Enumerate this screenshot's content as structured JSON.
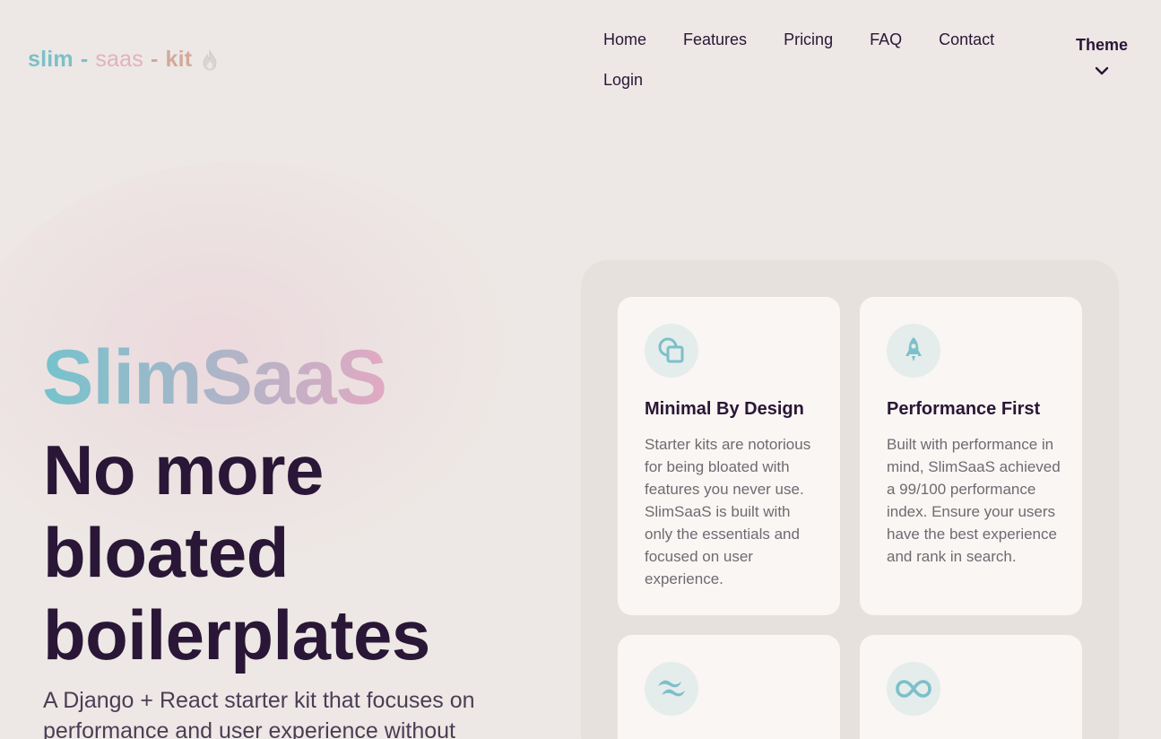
{
  "logo": {
    "part1": "slim",
    "sep1": "-",
    "part2": "saas",
    "sep2": "-",
    "part3": "kit",
    "icon": "flame-icon"
  },
  "nav": {
    "items": [
      {
        "label": "Home"
      },
      {
        "label": "Features"
      },
      {
        "label": "Pricing"
      },
      {
        "label": "FAQ"
      },
      {
        "label": "Contact"
      },
      {
        "label": "Login"
      }
    ]
  },
  "theme": {
    "label": "Theme",
    "icon": "chevron-down-icon"
  },
  "hero": {
    "brand": "SlimSaaS",
    "title": "No more bloated boilerplates",
    "subtitle": "A Django + React starter kit that focuses on performance and user experience without"
  },
  "features": [
    {
      "icon": "squares-icon",
      "title": "Minimal By Design",
      "text": "Starter kits are notorious for being bloated with features you never use. SlimSaaS is built with only the essentials and focused on user experience."
    },
    {
      "icon": "rocket-icon",
      "title": "Performance First",
      "text": "Built with performance in mind, SlimSaaS achieved a 99/100 performance index. Ensure your users have the best experience and rank in search."
    },
    {
      "icon": "tailwind-icon",
      "title": "",
      "text": ""
    },
    {
      "icon": "infinity-icon",
      "title": "",
      "text": ""
    }
  ],
  "colors": {
    "background": "#ede8e5",
    "accent_teal": "#7cc0c9",
    "accent_pink": "#e3b1bf",
    "accent_tan": "#d2a99a",
    "heading": "#2a1636"
  }
}
